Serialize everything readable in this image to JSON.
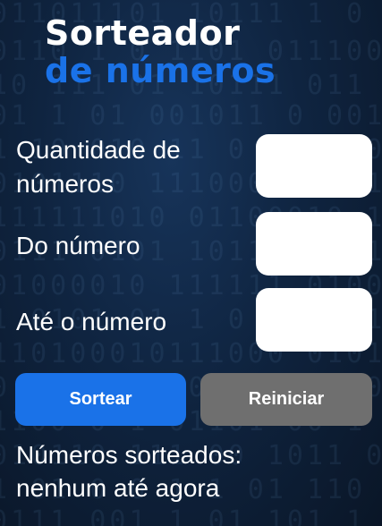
{
  "title": {
    "line1": "Sorteador",
    "line2": "de números"
  },
  "form": {
    "quantity_label": "Quantidade de números",
    "from_label": "Do número",
    "to_label": "Até o número",
    "quantity_value": "",
    "from_value": "",
    "to_value": ""
  },
  "buttons": {
    "draw_label": "Sortear",
    "reset_label": "Reiniciar"
  },
  "result": {
    "heading": "Números sorteados:",
    "text": "nenhum até agora"
  },
  "colors": {
    "accent": "#1a72e8",
    "button_primary": "#1a72e8",
    "button_secondary": "#6f6f6f",
    "background": "#0f2440",
    "text": "#ffffff"
  }
}
